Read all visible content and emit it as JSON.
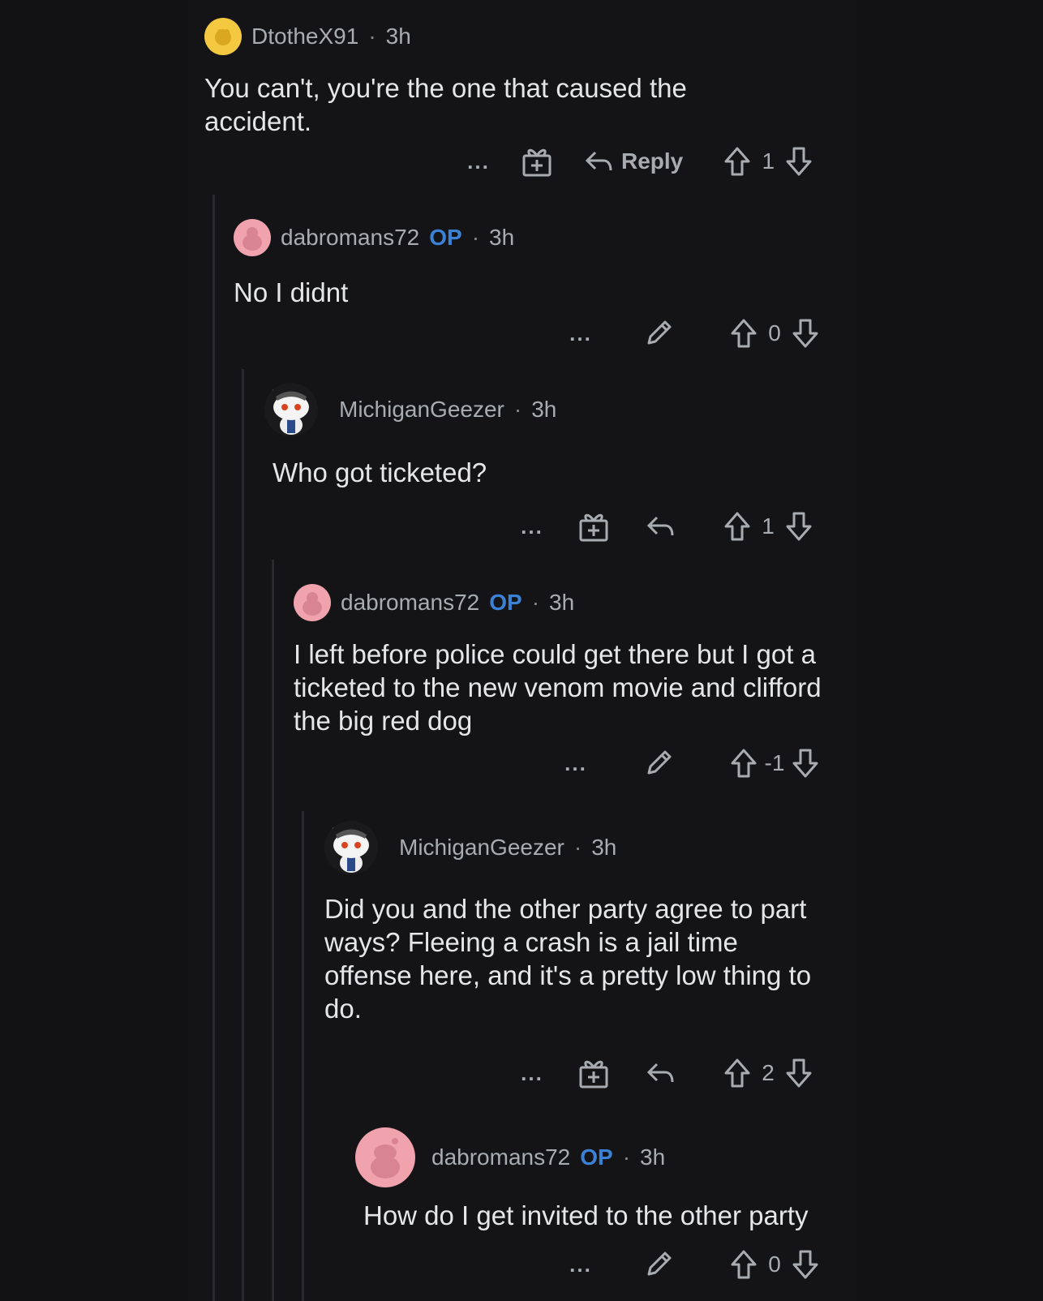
{
  "comments": [
    {
      "username": "DtotheX91",
      "op": "",
      "time": "3h",
      "text": "You can't, you're the one that caused the accident.",
      "reply_label": "Reply",
      "score": "1",
      "more": "...",
      "separator": "·"
    },
    {
      "username": "dabromans72",
      "op": "OP",
      "time": "3h",
      "text": "No I didnt",
      "score": "0",
      "more": "...",
      "separator": "·"
    },
    {
      "username": "MichiganGeezer",
      "op": "",
      "time": "3h",
      "text": "Who got ticketed?",
      "score": "1",
      "more": "...",
      "separator": "·"
    },
    {
      "username": "dabromans72",
      "op": "OP",
      "time": "3h",
      "text": "I left before police could get there but I got a ticketed to the new venom movie and clifford the big red dog",
      "score": "-1",
      "more": "...",
      "separator": "·"
    },
    {
      "username": "MichiganGeezer",
      "op": "",
      "time": "3h",
      "text": "Did you and the other party agree to part ways? Fleeing a crash is a jail time offense here, and it's a pretty low thing to do.",
      "score": "2",
      "more": "...",
      "separator": "·"
    },
    {
      "username": "dabromans72",
      "op": "OP",
      "time": "3h",
      "text": "How do I get invited to the other party",
      "score": "0",
      "more": "...",
      "separator": "·"
    }
  ],
  "icons": {
    "upvote": "upvote-icon",
    "downvote": "downvote-icon",
    "award": "award-icon",
    "reply": "reply-icon",
    "edit": "pencil-icon"
  },
  "colors": {
    "background": "#121214",
    "op": "#3b82d6",
    "text": "#e4e6e8",
    "meta": "#a8acb0"
  }
}
